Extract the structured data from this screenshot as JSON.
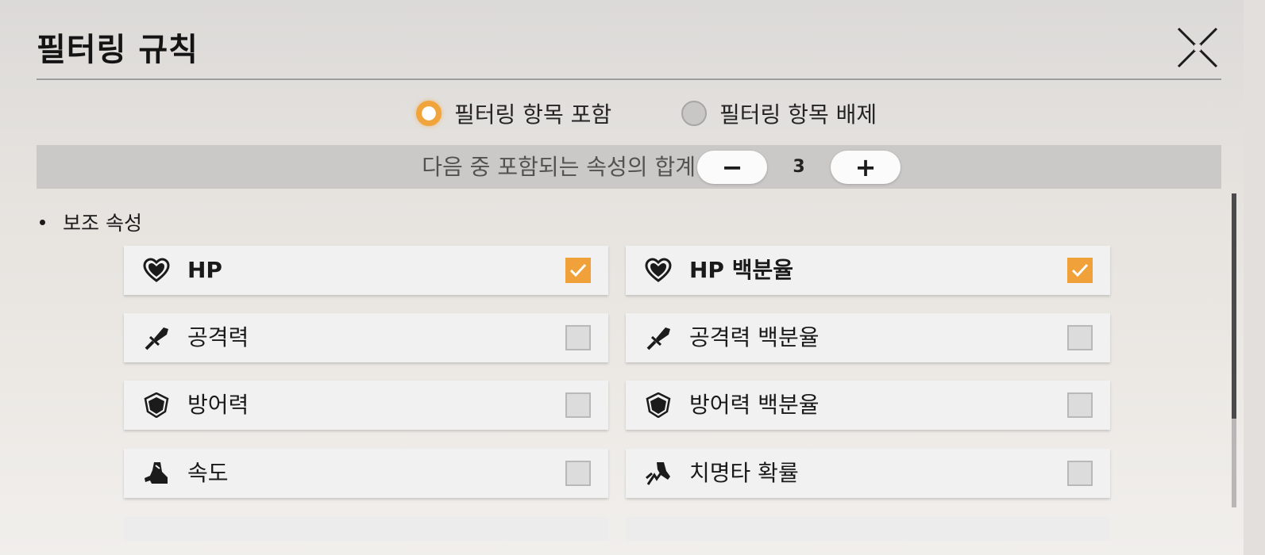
{
  "dialog": {
    "title": "필터링 규칙"
  },
  "mode": {
    "include_label": "필터링 항목 포함",
    "exclude_label": "필터링 항목 배제",
    "selected": "include"
  },
  "sum": {
    "label": "다음 중 포함되는 속성의 합계",
    "minus_label": "−",
    "plus_label": "+",
    "value": "3"
  },
  "section": {
    "title": "보조 속성"
  },
  "options": [
    {
      "label": "HP",
      "icon": "heart-icon",
      "checked": true
    },
    {
      "label": "HP 백분율",
      "icon": "heart-icon",
      "checked": true
    },
    {
      "label": "공격력",
      "icon": "sword-icon",
      "checked": false
    },
    {
      "label": "공격력 백분율",
      "icon": "sword-icon",
      "checked": false
    },
    {
      "label": "방어력",
      "icon": "shield-icon",
      "checked": false
    },
    {
      "label": "방어력 백분율",
      "icon": "shield-icon",
      "checked": false
    },
    {
      "label": "속도",
      "icon": "boot-icon",
      "checked": false
    },
    {
      "label": "치명타 확률",
      "icon": "critical-icon",
      "checked": false
    }
  ],
  "colors": {
    "accent": "#f0a13a",
    "panel": "#e6e3df",
    "row": "#f1f1f1",
    "bar": "#cbc9c7"
  }
}
